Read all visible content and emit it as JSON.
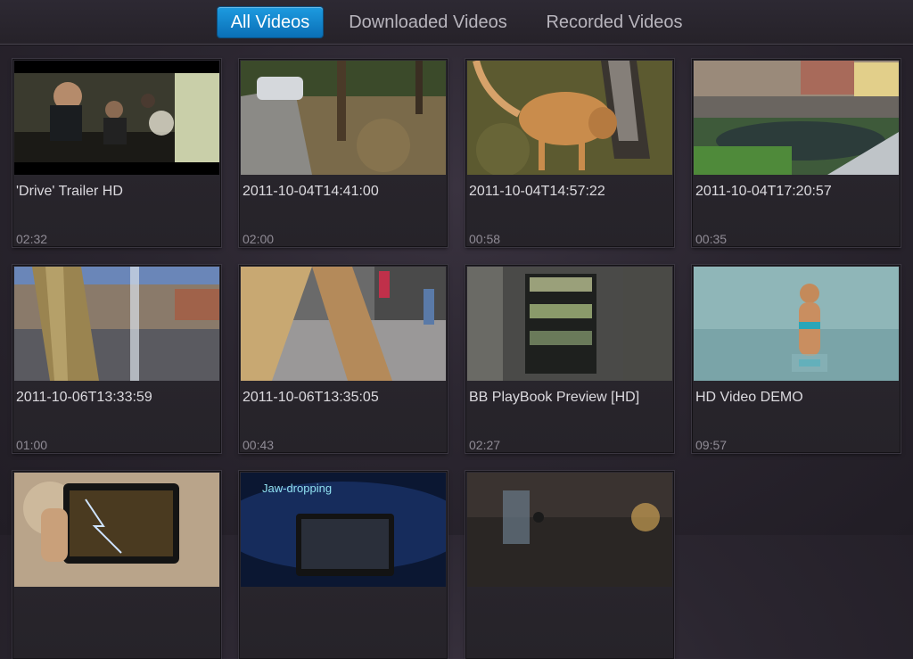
{
  "tabs": [
    {
      "label": "All Videos",
      "active": true
    },
    {
      "label": "Downloaded Videos",
      "active": false
    },
    {
      "label": "Recorded Videos",
      "active": false
    }
  ],
  "videos": [
    {
      "title": "'Drive' Trailer HD",
      "duration": "02:32"
    },
    {
      "title": "2011-10-04T14:41:00",
      "duration": "02:00"
    },
    {
      "title": "2011-10-04T14:57:22",
      "duration": "00:58"
    },
    {
      "title": "2011-10-04T17:20:57",
      "duration": "00:35"
    },
    {
      "title": "2011-10-06T13:33:59",
      "duration": "01:00"
    },
    {
      "title": "2011-10-06T13:35:05",
      "duration": "00:43"
    },
    {
      "title": "BB PlayBook Preview [HD]",
      "duration": "02:27"
    },
    {
      "title": "HD Video DEMO",
      "duration": "09:57"
    },
    {
      "title": "",
      "duration": ""
    },
    {
      "title": "",
      "duration": "",
      "thumb_text": [
        "Jaw-dropping"
      ]
    },
    {
      "title": "",
      "duration": ""
    }
  ],
  "colors": {
    "accent": "#1b8fd6",
    "background": "#2b2630"
  }
}
